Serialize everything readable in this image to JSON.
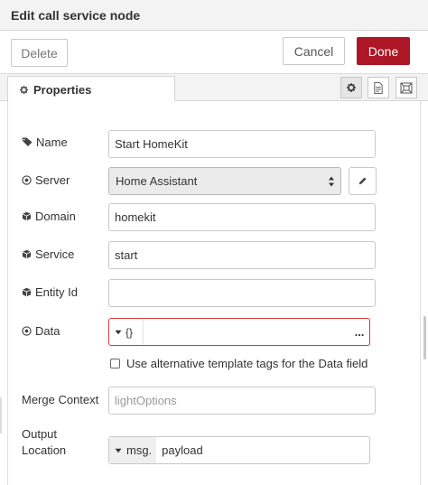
{
  "dialog": {
    "title": "Edit call service node"
  },
  "actions": {
    "delete_label": "Delete",
    "cancel_label": "Cancel",
    "done_label": "Done"
  },
  "tabs": {
    "properties_label": "Properties"
  },
  "form": {
    "name": {
      "label": "Name",
      "value": "Start HomeKit"
    },
    "server": {
      "label": "Server",
      "selected": "Home Assistant"
    },
    "domain": {
      "label": "Domain",
      "value": "homekit"
    },
    "service": {
      "label": "Service",
      "value": "start"
    },
    "entity_id": {
      "label": "Entity Id",
      "value": ""
    },
    "data": {
      "label": "Data",
      "type_symbol": "{}",
      "value": "",
      "more": "..."
    },
    "alt_tags": {
      "label": "Use alternative template tags for the Data field",
      "checked": false
    },
    "merge_context": {
      "label": "Merge Context",
      "placeholder": "lightOptions"
    },
    "output_location": {
      "label_line1": "Output",
      "label_line2": "Location",
      "type_prefix": "msg.",
      "value": "payload"
    }
  },
  "colors": {
    "accent": "#ad1625",
    "error_border": "#d03a3a"
  },
  "icons": [
    "gear-icon",
    "description-icon",
    "appearance-icon",
    "tag-icon",
    "target-icon",
    "cube-icon",
    "pencil-icon",
    "caret-down-icon",
    "select-arrows-icon"
  ]
}
